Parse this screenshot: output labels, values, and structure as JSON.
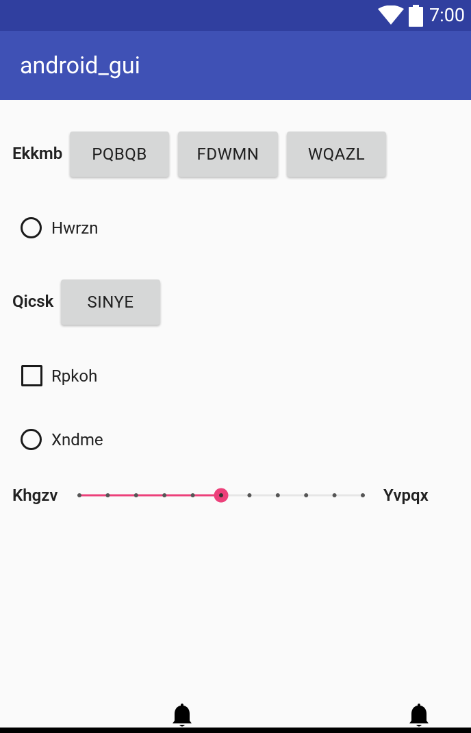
{
  "status_bar": {
    "time": "7:00",
    "wifi_icon": "wifi-icon",
    "battery_icon": "battery-icon"
  },
  "app_bar": {
    "title": "android_gui"
  },
  "row1": {
    "label": "Ekkmb",
    "buttons": [
      "PQBQB",
      "FDWMN",
      "WQAZL"
    ]
  },
  "radio1": {
    "label": "Hwrzn",
    "checked": false
  },
  "row2": {
    "label": "Qicsk",
    "button": "SINYE"
  },
  "checkbox1": {
    "label": "Rpkoh",
    "checked": false
  },
  "radio2": {
    "label": "Xndme",
    "checked": false
  },
  "seekbar": {
    "start_label": "Khgzv",
    "end_label": "Yvpqx",
    "min": 0,
    "max": 10,
    "value": 5,
    "accent_color": "#ec407a"
  },
  "bottom": {
    "icons": [
      "bell-icon",
      "bell-icon"
    ]
  }
}
